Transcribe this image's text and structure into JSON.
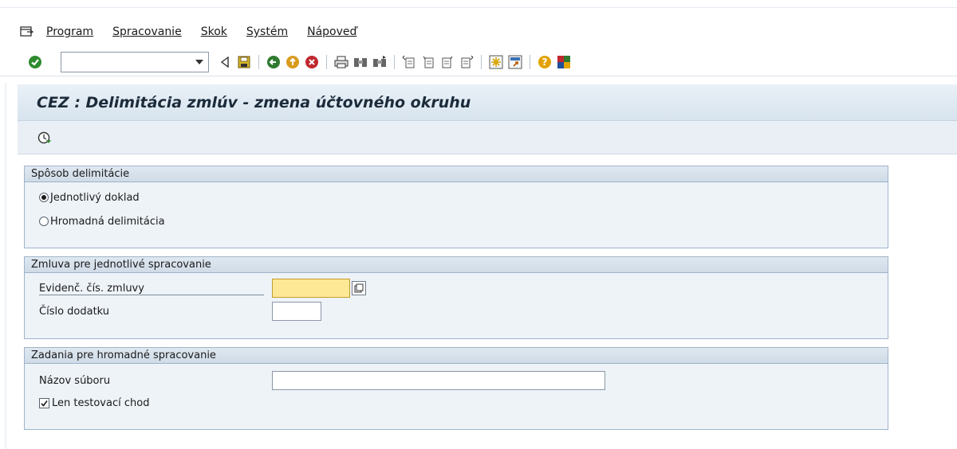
{
  "menu": {
    "items": [
      "Program",
      "Spracovanie",
      "Skok",
      "Systém",
      "Nápoveď"
    ]
  },
  "toolbar": {
    "command_field_value": "",
    "icons": [
      "enter-icon",
      "back-triangle-icon",
      "save-icon",
      "back-icon",
      "exit-icon",
      "cancel-icon",
      "print-icon",
      "find-icon",
      "find-next-icon",
      "first-page-icon",
      "previous-page-icon",
      "next-page-icon",
      "last-page-icon",
      "new-session-icon",
      "shortcut-icon",
      "help-icon",
      "layout-menu-icon"
    ]
  },
  "title": "CEZ : Delimitácia zmlúv - zmena účtovného okruhu",
  "sections": {
    "method": {
      "title": "Spôsob delimitácie",
      "options": [
        "Jednotlivý doklad",
        "Hromadná delimitácia"
      ],
      "selected": "Jednotlivý doklad"
    },
    "single": {
      "title": "Zmluva pre jednotlivé spracovanie",
      "contract_label": "Evidenč. čís. zmluvy",
      "contract_value": "",
      "addendum_label": "Číslo dodatku",
      "addendum_value": ""
    },
    "bulk": {
      "title": "Zadania pre hromadné spracovanie",
      "file_label": "Názov súboru",
      "file_value": "",
      "test_label": "Len testovací chod",
      "test_checked": true
    }
  },
  "colors": {
    "title_bg": "#dbe6f0",
    "group_bg": "#eef3f8",
    "focused_field": "#fde896"
  }
}
